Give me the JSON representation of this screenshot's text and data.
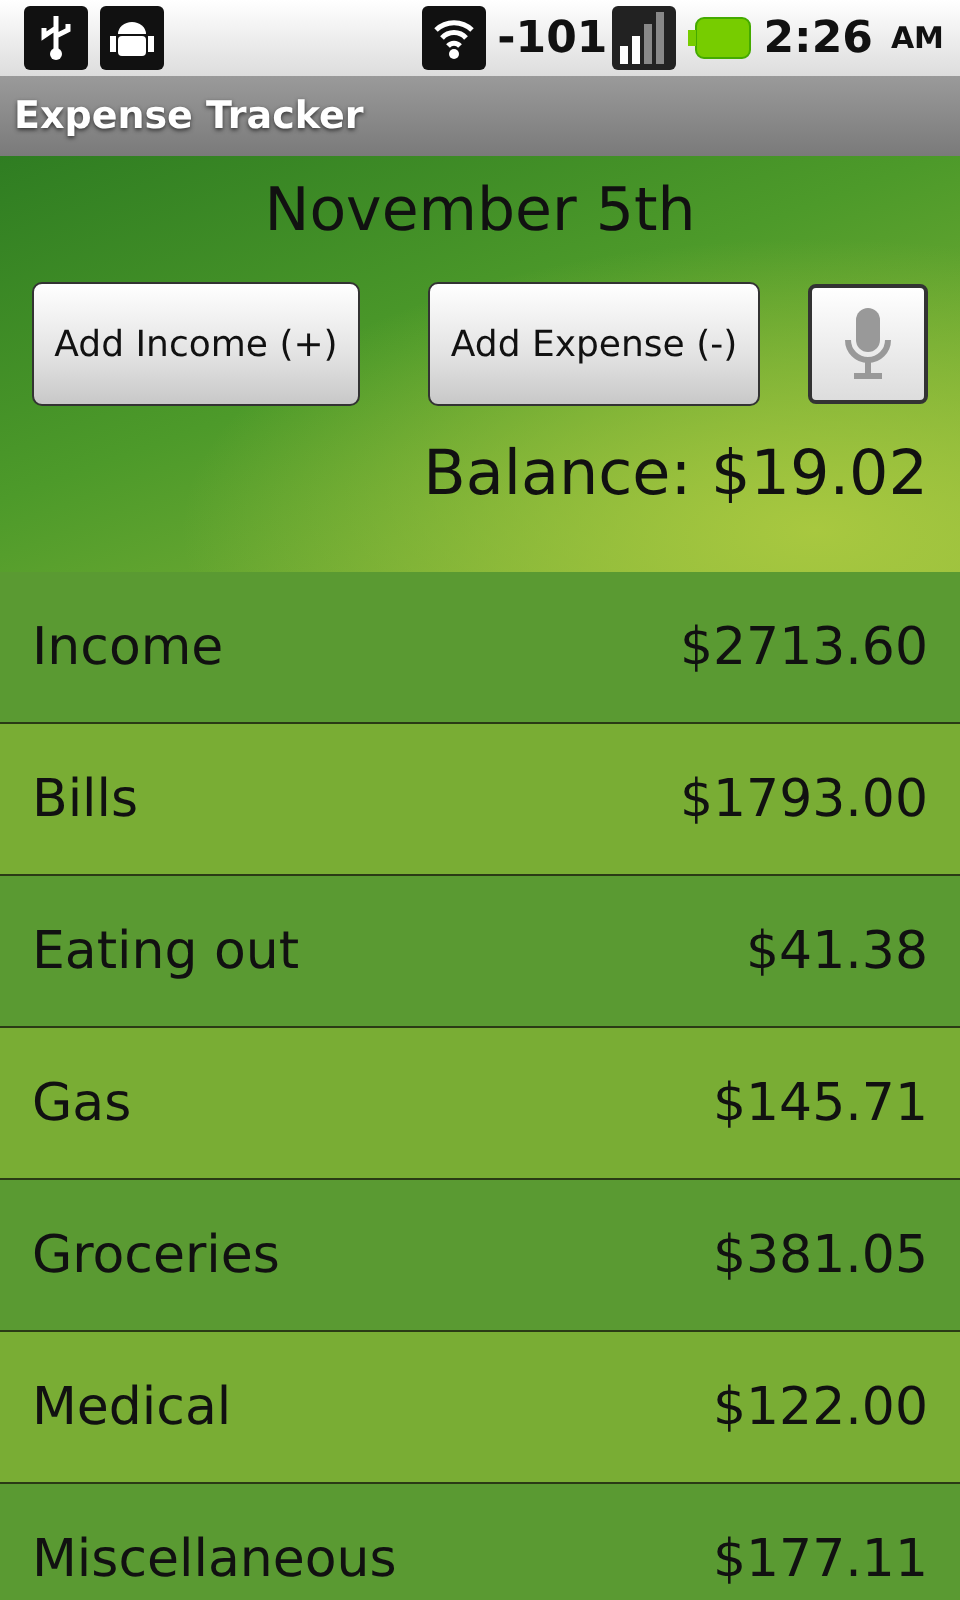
{
  "status_bar": {
    "signal_reading": "-101",
    "time": "2:26",
    "meridiem": "AM"
  },
  "window": {
    "title": "Expense Tracker"
  },
  "header": {
    "date": "November 5th",
    "buttons": [
      {
        "label": "Add Income (+)"
      },
      {
        "label": "Add Expense (-)"
      }
    ],
    "balance": "Balance: $19.02"
  },
  "categories": [
    {
      "name": "Income",
      "amount": "$2713.60"
    },
    {
      "name": "Bills",
      "amount": "$1793.00"
    },
    {
      "name": "Eating out",
      "amount": "$41.38"
    },
    {
      "name": "Gas",
      "amount": "$145.71"
    },
    {
      "name": "Groceries",
      "amount": "$381.05"
    },
    {
      "name": "Medical",
      "amount": "$122.00"
    },
    {
      "name": "Miscellaneous",
      "amount": "$177.11"
    }
  ]
}
